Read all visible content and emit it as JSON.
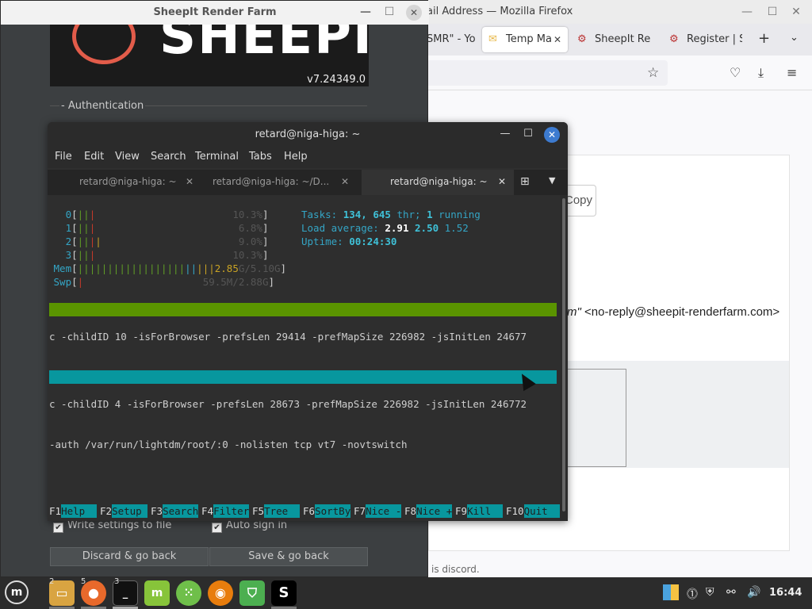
{
  "firefox": {
    "title": "ail Address — Mozilla Firefox",
    "tabs": [
      {
        "label": "SMR\" - Yo",
        "active": false
      },
      {
        "label": "Temp Ma",
        "active": true
      },
      {
        "label": "SheepIt Re",
        "active": false
      },
      {
        "label": "Register | S",
        "active": false
      }
    ],
    "new_tab": "+",
    "copy_label": "Copy",
    "sender_name": "rm\"",
    "sender_email": "<no-reply@sheepit-renderfarm.com>",
    "footer_text": "is discord."
  },
  "sheepit": {
    "title": "SheepIt Render Farm",
    "logo_text": "SHEEPIT",
    "version": "v7.24349.0",
    "auth_section": "- Authentication",
    "write_settings_label": "Write settings to file",
    "auto_signin_label": "Auto sign in",
    "discard_label": "Discard & go back",
    "save_label": "Save & go back"
  },
  "terminal": {
    "title": "retard@niga-higa: ~",
    "menu": [
      "File",
      "Edit",
      "View",
      "Search",
      "Terminal",
      "Tabs",
      "Help"
    ],
    "tabs": [
      {
        "label": "retard@niga-higa: ~",
        "active": false
      },
      {
        "label": "retard@niga-higa: ~/D...",
        "active": false
      },
      {
        "label": "retard@niga-higa: ~",
        "active": true
      }
    ],
    "htop": {
      "cpus": [
        {
          "id": "0",
          "pct": "10.3%"
        },
        {
          "id": "1",
          "pct": "6.8%"
        },
        {
          "id": "2",
          "pct": "9.0%"
        },
        {
          "id": "3",
          "pct": "10.3%"
        }
      ],
      "mem_label": "Mem",
      "mem_used": "2.85",
      "mem_total": "G/5.10G",
      "swp_label": "Swp",
      "swp_value": "59.5M/2.88G",
      "tasks_label": "Tasks:",
      "tasks": "134,",
      "threads": "645",
      "threads_label": "thr;",
      "running": "1",
      "running_label": "running",
      "load_label": "Load average:",
      "load1": "2.91",
      "load5": "2.50",
      "load15": "1.52",
      "uptime_label": "Uptime:",
      "uptime": "00:24:30",
      "proc_line_1": "c -childID 10 -isForBrowser -prefsLen 29414 -prefMapSize 226982 -jsInitLen 24677",
      "proc_line_2": "c -childID 4 -isForBrowser -prefsLen 28673 -prefMapSize 226982 -jsInitLen 246772",
      "proc_line_3": "-auth /var/run/lightdm/root/:0 -nolisten tcp vt7 -novtswitch",
      "fkeys": [
        {
          "key": "F1",
          "label": "Help  "
        },
        {
          "key": "F2",
          "label": "Setup "
        },
        {
          "key": "F3",
          "label": "Search"
        },
        {
          "key": "F4",
          "label": "Filter"
        },
        {
          "key": "F5",
          "label": "Tree  "
        },
        {
          "key": "F6",
          "label": "SortBy"
        },
        {
          "key": "F7",
          "label": "Nice -"
        },
        {
          "key": "F8",
          "label": "Nice +"
        },
        {
          "key": "F9",
          "label": "Kill  "
        },
        {
          "key": "F10",
          "label": "Quit  "
        }
      ]
    }
  },
  "taskbar": {
    "badges": {
      "files": "2",
      "firefox": "5",
      "terminal": "3"
    },
    "terminal_glyph": "_",
    "sheepit_glyph": "S",
    "clock": "16:44"
  },
  "colors": {
    "htop_green_bar": "#5a9400",
    "htop_cyan_bar": "#08979e",
    "terminal_close": "#3d7bd0",
    "sheepit_logo_accent": "#e25c4a"
  }
}
